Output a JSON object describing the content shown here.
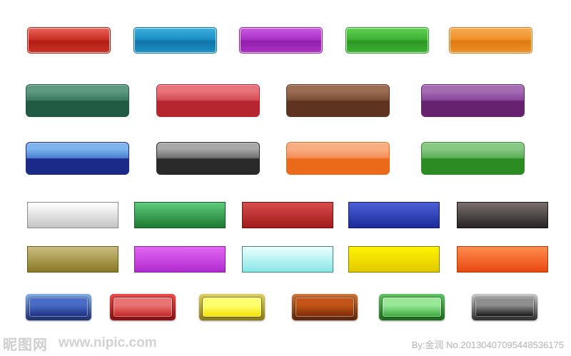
{
  "rows": [
    {
      "buttons": [
        {
          "light": "#e8655c",
          "base": "#cc3126",
          "dark": "#b01d13"
        },
        {
          "light": "#3fb0de",
          "base": "#1b90c6",
          "dark": "#1174a8"
        },
        {
          "light": "#c95ce0",
          "base": "#ab30c6",
          "dark": "#9020ac"
        },
        {
          "light": "#62d155",
          "base": "#3cb232",
          "dark": "#2e9624"
        },
        {
          "light": "#f7ab55",
          "base": "#ef9028",
          "dark": "#de7912"
        }
      ]
    },
    {
      "buttons": [
        {
          "light": "#5e9a82",
          "base": "#3a7a60",
          "dark": "#225b43"
        },
        {
          "light": "#e8747b",
          "base": "#d14a52",
          "dark": "#b5262f"
        },
        {
          "light": "#9b6d52",
          "base": "#7a4c33",
          "dark": "#5e3420"
        },
        {
          "light": "#a46db2",
          "base": "#86449a",
          "dark": "#66226f"
        }
      ]
    },
    {
      "buttons": [
        {
          "light": "#7db4ee",
          "base": "#4a7fd0",
          "dark": "#1b2a86"
        },
        {
          "light": "#a8a8a8",
          "base": "#6e6e6e",
          "dark": "#2a2a2a"
        },
        {
          "light": "#f9ae82",
          "base": "#f48c56",
          "dark": "#ea6a1a"
        },
        {
          "light": "#88c885",
          "base": "#59ae56",
          "dark": "#2b8c24"
        }
      ]
    },
    {
      "buttons": [
        {
          "top": "#ffffff",
          "bottom": "#c4c4c4",
          "border": "#8a8a8a"
        },
        {
          "top": "#5fcb7c",
          "bottom": "#1d7a30",
          "border": "#185a26"
        },
        {
          "top": "#d84c4c",
          "bottom": "#a01b1b",
          "border": "#741010"
        },
        {
          "top": "#4c60d8",
          "bottom": "#1b2a98",
          "border": "#101a68"
        },
        {
          "top": "#7a6f6f",
          "bottom": "#282222",
          "border": "#181212"
        }
      ]
    },
    {
      "buttons": [
        {
          "top": "#cbbd80",
          "bottom": "#887826",
          "border": "#6a5a18"
        },
        {
          "top": "#e266f2",
          "bottom": "#b02cd0",
          "border": "#8a1ca0"
        },
        {
          "top": "#ecffff",
          "bottom": "#88e6e6",
          "border": "#3e8a8a"
        },
        {
          "top": "#fff400",
          "bottom": "#e2c800",
          "border": "#8a7a00"
        },
        {
          "top": "#ff8c4e",
          "bottom": "#e84812",
          "border": "#b03a00"
        }
      ]
    },
    {
      "buttons": [
        {
          "frame_top": "#7fb0ea",
          "frame_bottom": "#1c2f72",
          "inner_top": "#4a6cc4",
          "inner_bottom": "#1a2c82"
        },
        {
          "frame_top": "#ee4a4a",
          "frame_bottom": "#8a0e0e",
          "inner_top": "#e87474",
          "inner_bottom": "#c42424"
        },
        {
          "frame_top": "#ddd060",
          "frame_bottom": "#8a7a10",
          "inner_top": "#ffff70",
          "inner_bottom": "#f2e000"
        },
        {
          "frame_top": "#d07438",
          "frame_bottom": "#5e2406",
          "inner_top": "#c25418",
          "inner_bottom": "#7a2a06"
        },
        {
          "frame_top": "#62c262",
          "frame_bottom": "#1a6a1a",
          "inner_top": "#98e898",
          "inner_bottom": "#3aa63a"
        },
        {
          "frame_top": "#c8c8c8",
          "frame_bottom": "#2e2e2e",
          "inner_top": "#8e8e8e",
          "inner_bottom": "#101010"
        }
      ]
    }
  ],
  "watermark": {
    "logo": "昵图网",
    "url": "www.nipic.com",
    "credit": "By:金润  No.20130407095448536175"
  }
}
